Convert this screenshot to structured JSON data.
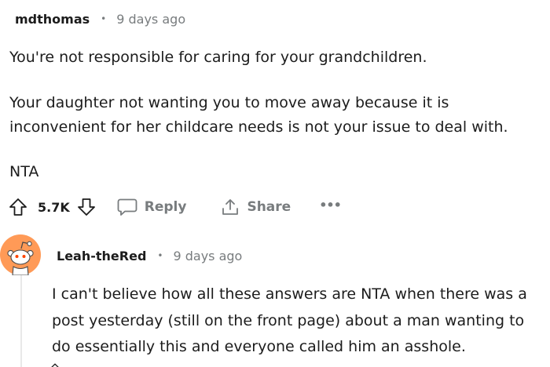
{
  "comment": {
    "author": "mdthomas",
    "separator": "•",
    "time": "9 days ago",
    "paragraphs": {
      "p1": "You're not responsible for caring for your grandchildren.",
      "p2_line1": "Your daughter not wanting you to move away because it is",
      "p2_line2": "inconvenient for her childcare needs is not your issue to deal with.",
      "p3": "NTA"
    },
    "actions": {
      "upvote_icon": "arrow-up-outline-icon",
      "score": "5.7K",
      "downvote_icon": "arrow-down-outline-icon",
      "reply_icon": "speech-bubble-icon",
      "reply_label": "Reply",
      "share_icon": "share-upload-icon",
      "share_label": "Share",
      "more_label": "•••"
    }
  },
  "reply": {
    "avatar_icon": "reddit-snoo-avatar-icon",
    "avatar_color": "#ff9a57",
    "author": "Leah-theRed",
    "separator": "•",
    "time": "9 days ago",
    "lines": {
      "l1": "I can't believe how all these answers are NTA when there was a",
      "l2": "post yesterday (still on the front page) about a man wanting to",
      "l3": "do essentially this and everyone called him an asshole."
    }
  },
  "colors": {
    "text": "#1c1c1c",
    "muted": "#787c7e",
    "thread_line": "#e8e8e8"
  }
}
